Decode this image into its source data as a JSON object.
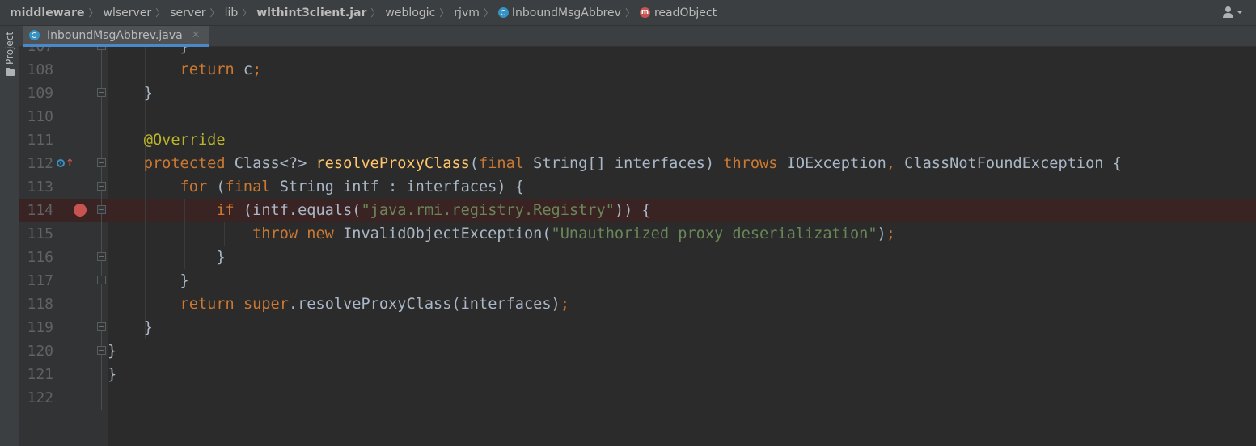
{
  "breadcrumb": {
    "items": [
      {
        "label": "middleware",
        "bold": true
      },
      {
        "label": "wlserver",
        "bold": false
      },
      {
        "label": "server",
        "bold": false
      },
      {
        "label": "lib",
        "bold": false
      },
      {
        "label": "wlthint3client.jar",
        "bold": true
      },
      {
        "label": "weblogic",
        "bold": false
      },
      {
        "label": "rjvm",
        "bold": false
      },
      {
        "label": "InboundMsgAbbrev",
        "bold": false,
        "icon": "class-icon"
      },
      {
        "label": "readObject",
        "bold": false,
        "icon": "method-icon"
      }
    ],
    "method_icon_letter": "m"
  },
  "toolstrip": {
    "project_label": "Project"
  },
  "tabs": [
    {
      "label": "InboundMsgAbbrev.java",
      "icon": "class-icon",
      "active": true
    }
  ],
  "editor": {
    "lines": [
      {
        "num": "107",
        "tokens": [
          [
            "",
            "        }"
          ]
        ],
        "fold": true
      },
      {
        "num": "108",
        "tokens": [
          [
            "kw",
            "        return"
          ],
          [
            "",
            " c"
          ],
          [
            "kw",
            ";"
          ]
        ]
      },
      {
        "num": "109",
        "tokens": [
          [
            "",
            "    }"
          ]
        ],
        "fold": true
      },
      {
        "num": "110",
        "tokens": []
      },
      {
        "num": "111",
        "tokens": [
          [
            "ann",
            "    @Override"
          ]
        ]
      },
      {
        "num": "112",
        "tokens": [
          [
            "kw",
            "    protected"
          ],
          [
            "",
            " Class<?> "
          ],
          [
            "fn",
            "resolveProxyClass"
          ],
          [
            "",
            "("
          ],
          [
            "kw",
            "final"
          ],
          [
            "",
            " String[] interfaces) "
          ],
          [
            "kw",
            "throws"
          ],
          [
            "",
            " IOException"
          ],
          [
            "kw",
            ","
          ],
          [
            "",
            " ClassNotFoundException {"
          ]
        ],
        "fold": true,
        "override": true
      },
      {
        "num": "113",
        "tokens": [
          [
            "kw",
            "        for"
          ],
          [
            "",
            " ("
          ],
          [
            "kw",
            "final"
          ],
          [
            "",
            " String intf : interfaces) {"
          ]
        ],
        "fold": true
      },
      {
        "num": "114",
        "tokens": [
          [
            "kw",
            "            if"
          ],
          [
            "",
            " (intf.equals("
          ],
          [
            "str",
            "\"java.rmi.registry.Registry\""
          ],
          [
            "",
            ")) {"
          ]
        ],
        "fold": true,
        "breakpoint": true
      },
      {
        "num": "115",
        "tokens": [
          [
            "kw",
            "                throw new"
          ],
          [
            "",
            " InvalidObjectException("
          ],
          [
            "str",
            "\"Unauthorized proxy deserialization\""
          ],
          [
            "",
            ")"
          ],
          [
            "kw",
            ";"
          ]
        ]
      },
      {
        "num": "116",
        "tokens": [
          [
            "",
            "            }"
          ]
        ],
        "fold": true
      },
      {
        "num": "117",
        "tokens": [
          [
            "",
            "        }"
          ]
        ],
        "fold": true
      },
      {
        "num": "118",
        "tokens": [
          [
            "kw",
            "        return"
          ],
          [
            "",
            " "
          ],
          [
            "kw",
            "super"
          ],
          [
            "",
            ".resolveProxyClass(interfaces)"
          ],
          [
            "kw",
            ";"
          ]
        ]
      },
      {
        "num": "119",
        "tokens": [
          [
            "",
            "    }"
          ]
        ],
        "fold": true
      },
      {
        "num": "120",
        "tokens": [
          [
            "",
            "}"
          ]
        ],
        "fold": true
      },
      {
        "num": "121",
        "tokens": [
          [
            "",
            "}"
          ]
        ]
      },
      {
        "num": "122",
        "tokens": []
      }
    ]
  },
  "colors": {
    "keyword": "#cc7832",
    "string": "#6a8759",
    "annotation": "#bbb529",
    "method": "#ffc66d",
    "text": "#a9b7c6",
    "breakpoint": "#c75450"
  }
}
